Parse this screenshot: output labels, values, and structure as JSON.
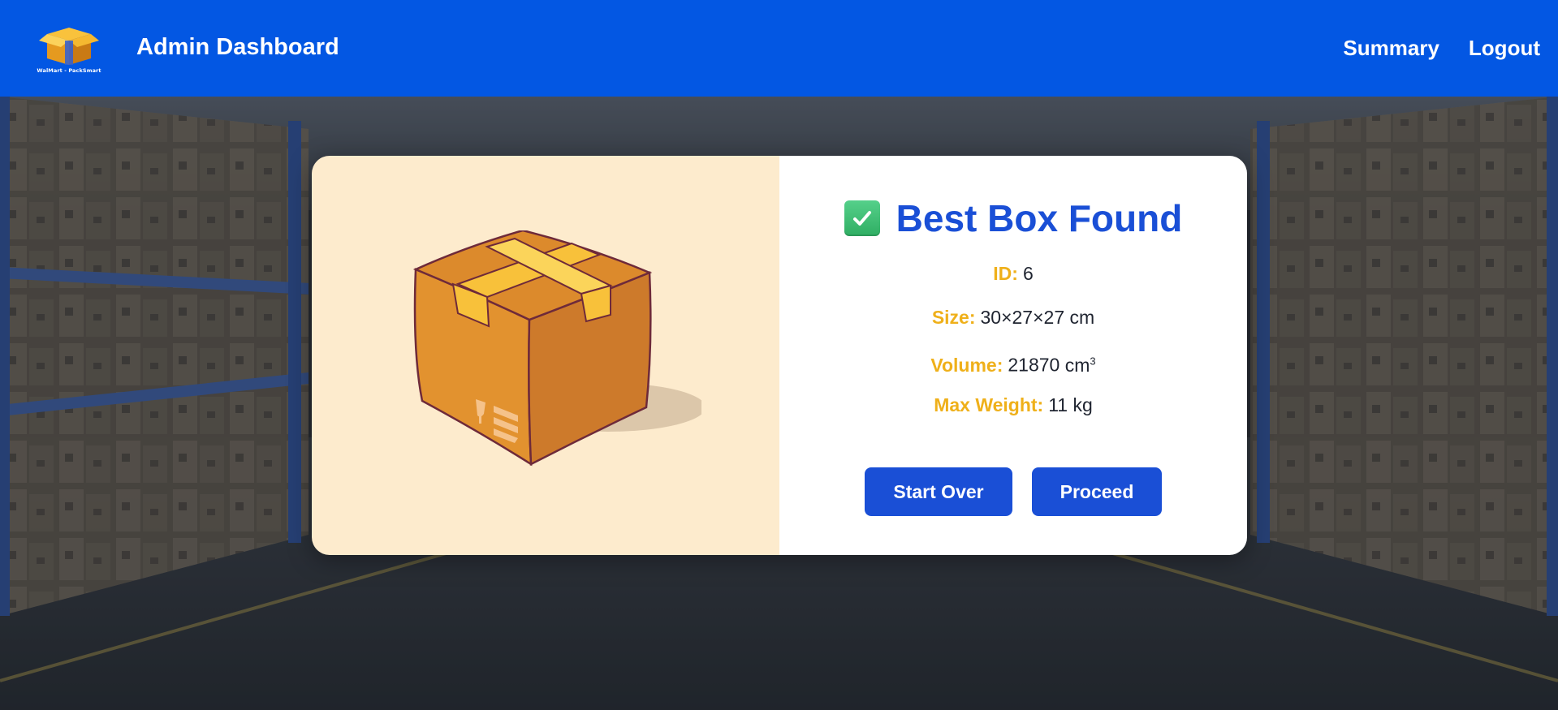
{
  "navbar": {
    "logo_caption": "WalMart - PackSmart",
    "title": "Admin Dashboard",
    "links": [
      "Summary",
      "Logout"
    ]
  },
  "result": {
    "title": "Best Box Found",
    "details": [
      {
        "label": "ID:",
        "value": "6",
        "unit": "",
        "sup": ""
      },
      {
        "label": "Size:",
        "value": "30×27×27",
        "unit": "cm",
        "sup": ""
      },
      {
        "label": "Volume:",
        "value": "21870",
        "unit": "cm",
        "sup": "3"
      },
      {
        "label": "Max Weight:",
        "value": "11",
        "unit": "kg",
        "sup": ""
      }
    ],
    "buttons": {
      "start_over": "Start Over",
      "proceed": "Proceed"
    }
  },
  "icons": {
    "logo": "box-logo-icon",
    "check": "check-box-icon",
    "box": "cardboard-box-illustration",
    "fragile": "fragile-glass-icon"
  },
  "colors": {
    "navbar": "#0357e3",
    "accent_blue": "#1a4fd6",
    "label_gold": "#efb01a",
    "image_panel": "#fdebcd"
  }
}
